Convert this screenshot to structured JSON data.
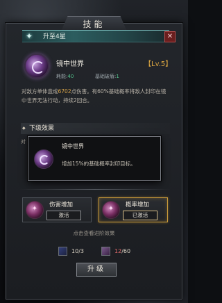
{
  "window": {
    "title": "技能"
  },
  "header": {
    "label": "升至4星",
    "close_symbol": "✕"
  },
  "skill": {
    "name": "镜中世界",
    "level": "【Lv.5】",
    "cost_label": "耗能:",
    "cost_value": "40",
    "break_label": "基础破盾:",
    "break_value": "1",
    "desc_before": "对敌方单体造成",
    "desc_damage": "6702",
    "desc_after": "点伤害。有60%基础概率将敌人封印在镜中世界无法行动，持续2回合。"
  },
  "sub_section": {
    "title": "下级效果",
    "behind_text": "对"
  },
  "popup": {
    "title": "镜中世界",
    "desc": "增加15%的基础概率封印目标。"
  },
  "effects": [
    {
      "name": "伤害增加",
      "button": "激活",
      "active": false
    },
    {
      "name": "概率增加",
      "button": "已激活",
      "active": true
    }
  ],
  "hint": "点击查看进阶效果",
  "resources": {
    "book": {
      "have": "10",
      "need": "3"
    },
    "scroll": {
      "have": "12",
      "need": "60"
    }
  },
  "upgrade_button": "升级",
  "colors": {
    "accent_gold": "#c99a3a",
    "teal_bar": "#2c5d5f",
    "damage_highlight": "#d6a348",
    "insufficient_red": "#e26b6b"
  }
}
